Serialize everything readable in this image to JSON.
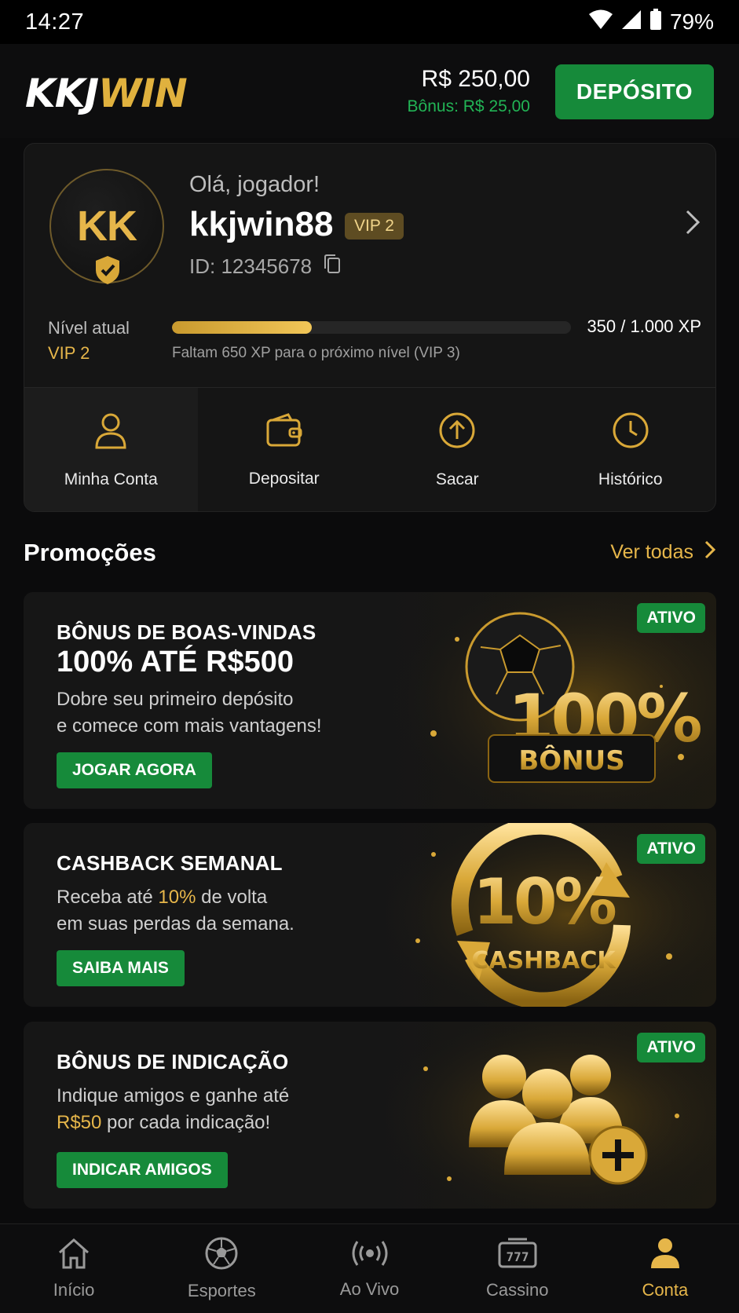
{
  "status_bar": {
    "time": "14:27",
    "battery": "79%"
  },
  "header": {
    "logo_part1": "KKJ",
    "logo_part2": "WIN",
    "balance": "R$ 250,00",
    "bonus": "Bônus: R$ 25,00",
    "deposit_label": "DEPÓSITO"
  },
  "profile": {
    "initials": "KK",
    "greeting": "Olá, jogador!",
    "username": "kkjwin88",
    "vip_badge": "VIP 2",
    "user_id": "ID: 12345678",
    "level_label": "Nível atual",
    "level_value": "VIP 2",
    "xp_text": "350 / 1.000 XP",
    "xp_progress": 0.35,
    "xp_hint": "Faltam 650 XP para o próximo nível (VIP 3)"
  },
  "quick_actions": [
    {
      "label": "Minha Conta",
      "icon": "user-icon"
    },
    {
      "label": "Depositar",
      "icon": "wallet-icon"
    },
    {
      "label": "Sacar",
      "icon": "withdraw-arrow-icon"
    },
    {
      "label": "Histórico",
      "icon": "clock-icon"
    }
  ],
  "promotions": {
    "title": "Promoções",
    "see_all": "Ver todas",
    "items": [
      {
        "badge": "ATIVO",
        "title": "BÔNUS DE BOAS-VINDAS",
        "headline": "100% ATÉ R$500",
        "desc_line1": "Dobre seu primeiro depósito",
        "desc_line2": "e comece com mais vantagens!",
        "cta": "JOGAR AGORA",
        "art_big": "100%",
        "art_small": "BÔNUS"
      },
      {
        "badge": "ATIVO",
        "title": "CASHBACK SEMANAL",
        "desc_line1_pre": "Receba até ",
        "desc_line1_hl": "10%",
        "desc_line1_post": " de volta",
        "desc_line2": "em suas perdas da semana.",
        "cta": "SAIBA MAIS",
        "art_big": "10%",
        "art_small": "CASHBACK"
      },
      {
        "badge": "ATIVO",
        "title": "BÔNUS DE INDICAÇÃO",
        "desc_line1": "Indique amigos e ganhe até",
        "desc_line2_hl": "R$50",
        "desc_line2_post": " por cada indicação!",
        "cta": "INDICAR AMIGOS"
      }
    ]
  },
  "bottom_nav": [
    {
      "label": "Início",
      "icon": "home-icon"
    },
    {
      "label": "Esportes",
      "icon": "soccer-ball-icon"
    },
    {
      "label": "Ao Vivo",
      "icon": "live-broadcast-icon"
    },
    {
      "label": "Cassino",
      "icon": "slot-machine-icon"
    },
    {
      "label": "Conta",
      "icon": "account-icon"
    }
  ],
  "colors": {
    "gold": "#e6b64a",
    "green": "#168a3a",
    "bonus_green": "#22b455",
    "background": "#0b0b0c"
  }
}
